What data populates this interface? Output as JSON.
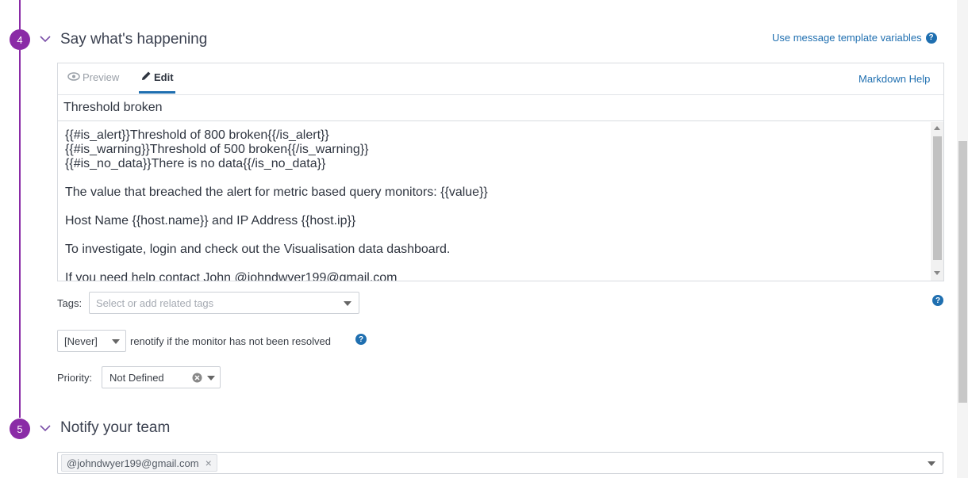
{
  "steps": [
    {
      "number": "4",
      "title": "Say what's happening"
    },
    {
      "number": "5",
      "title": "Notify your team"
    }
  ],
  "message": {
    "template_vars_link": "Use message template variables",
    "tabs": {
      "preview": "Preview",
      "edit": "Edit"
    },
    "markdown_help": "Markdown Help",
    "title_value": "Threshold broken",
    "body_lines": [
      "{{#is_alert}}Threshold of 800 broken{{/is_alert}}",
      "{{#is_warning}}Threshold of 500 broken{{/is_warning}}",
      "{{#is_no_data}}There is no data{{/is_no_data}}",
      "",
      "The value that breached the alert for metric based query monitors: {{value}}",
      "",
      "Host Name {{host.name}} and IP Address {{host.ip}}",
      "",
      "To investigate, login and check out the Visualisation data dashboard.",
      "",
      "If you need help contact John @johndwyer199@gmail.com"
    ]
  },
  "tags": {
    "label": "Tags:",
    "placeholder": "Select or add related tags"
  },
  "renotify": {
    "value": "[Never]",
    "text": "renotify if the monitor has not been resolved"
  },
  "priority": {
    "label": "Priority:",
    "value": "Not Defined"
  },
  "notify": {
    "recipients": [
      "@johndwyer199@gmail.com"
    ]
  },
  "icons": {
    "help": "question-circle-icon",
    "preview": "eye-icon",
    "edit": "pencil-icon"
  },
  "colors": {
    "accent": "#8a2ba6",
    "link": "#1f6fb0"
  }
}
